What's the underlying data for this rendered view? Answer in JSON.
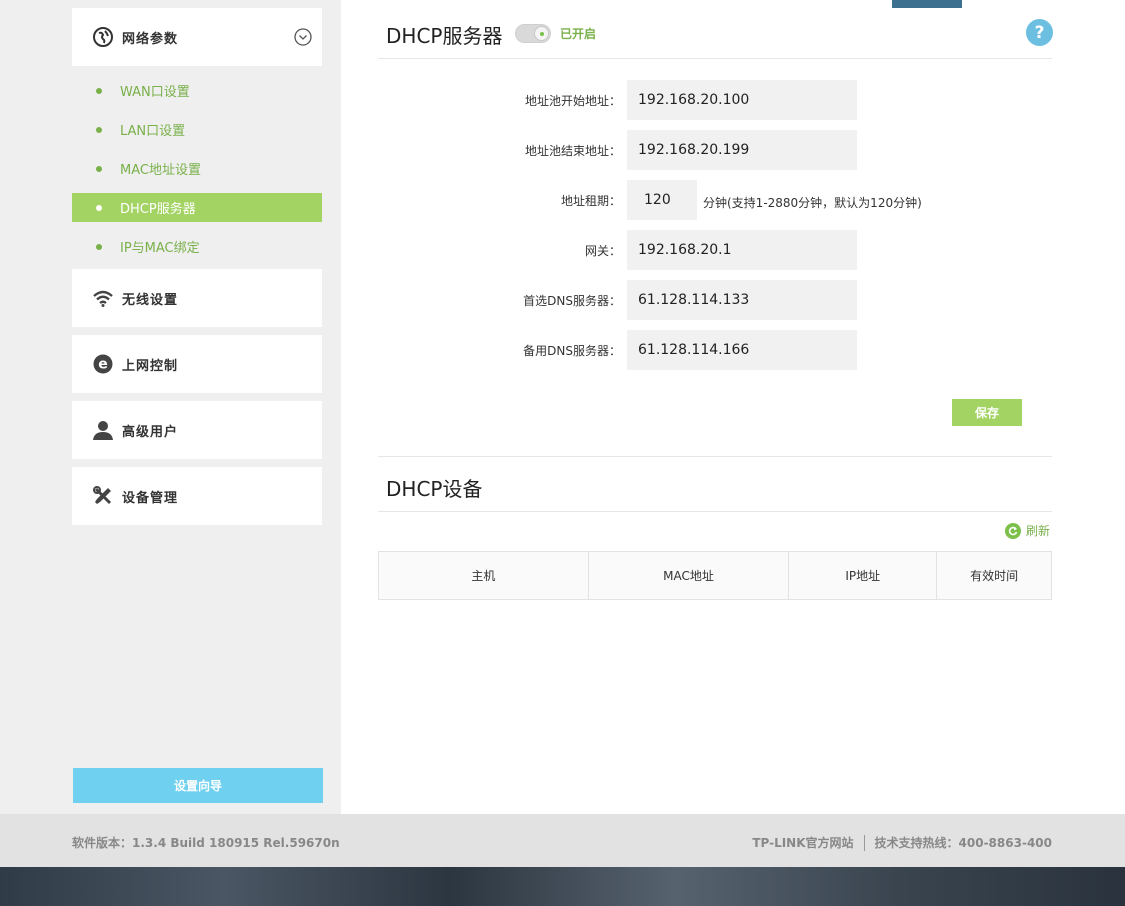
{
  "sidebar": {
    "network_params": "网络参数",
    "sub_items": [
      {
        "label": "WAN口设置",
        "active": false
      },
      {
        "label": "LAN口设置",
        "active": false
      },
      {
        "label": "MAC地址设置",
        "active": false
      },
      {
        "label": "DHCP服务器",
        "active": true
      },
      {
        "label": "IP与MAC绑定",
        "active": false
      }
    ],
    "wireless": "无线设置",
    "internet_control": "上网控制",
    "advanced_users": "高级用户",
    "device_management": "设备管理",
    "setup_wizard": "设置向导"
  },
  "dhcp_server": {
    "title": "DHCP服务器",
    "status": "已开启",
    "help": "?",
    "fields": {
      "pool_start_label": "地址池开始地址：",
      "pool_start_value": "192.168.20.100",
      "pool_end_label": "地址池结束地址：",
      "pool_end_value": "192.168.20.199",
      "lease_label": "地址租期：",
      "lease_value": "120",
      "lease_hint": "分钟(支持1-2880分钟，默认为120分钟)",
      "gateway_label": "网关：",
      "gateway_value": "192.168.20.1",
      "dns1_label": "首选DNS服务器：",
      "dns1_value": "61.128.114.133",
      "dns2_label": "备用DNS服务器：",
      "dns2_value": "61.128.114.166"
    },
    "save": "保存"
  },
  "dhcp_devices": {
    "title": "DHCP设备",
    "refresh": "刷新",
    "columns": [
      "主机",
      "MAC地址",
      "IP地址",
      "有效时间"
    ]
  },
  "footer": {
    "version": "软件版本：1.3.4 Build 180915 Rel.59670n",
    "official_site": "TP-LINK官方网站",
    "support": "技术支持热线：400-8863-400"
  },
  "colors": {
    "accent_green": "#a3d363",
    "text_green": "#79b04a",
    "wizard_blue": "#6fd1ef",
    "help_blue": "#6cbfe0"
  }
}
